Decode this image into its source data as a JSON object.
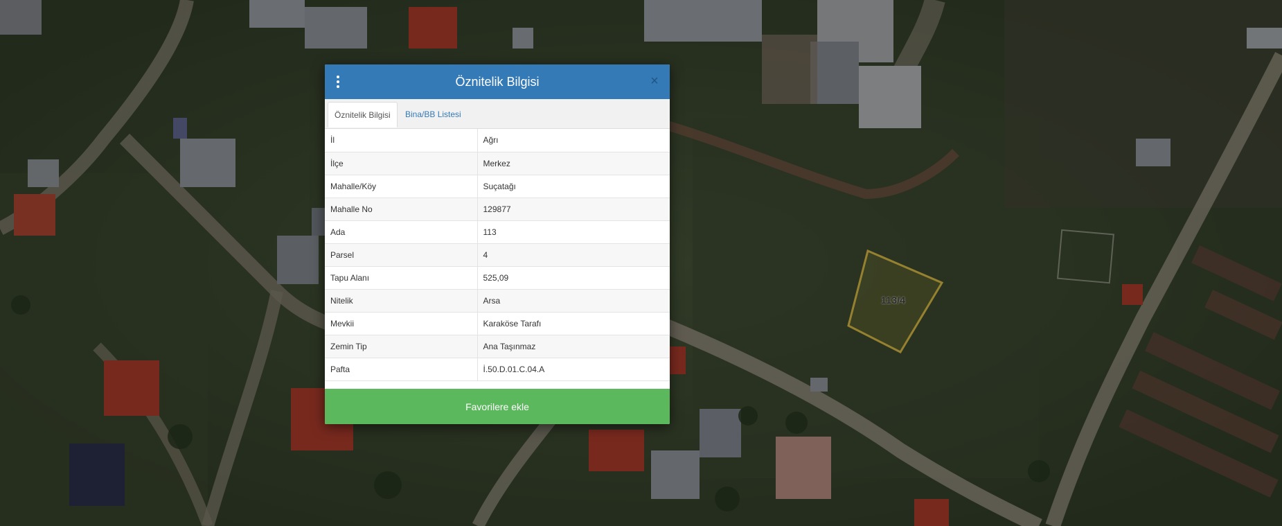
{
  "dialog": {
    "title": "Öznitelik Bilgisi",
    "menu_icon": "vertical-ellipsis-icon",
    "close_icon": "close-icon",
    "close_glyph": "×",
    "tabs": [
      {
        "label": "Öznitelik Bilgisi",
        "active": true
      },
      {
        "label": "Bina/BB Listesi",
        "active": false
      }
    ],
    "attributes": [
      {
        "key": "İl",
        "value": "Ağrı"
      },
      {
        "key": "İlçe",
        "value": "Merkez"
      },
      {
        "key": "Mahalle/Köy",
        "value": "Suçatağı"
      },
      {
        "key": "Mahalle No",
        "value": "129877"
      },
      {
        "key": "Ada",
        "value": "113"
      },
      {
        "key": "Parsel",
        "value": "4"
      },
      {
        "key": "Tapu Alanı",
        "value": "525,09"
      },
      {
        "key": "Nitelik",
        "value": "Arsa"
      },
      {
        "key": "Mevkii",
        "value": "Karaköse Tarafı"
      },
      {
        "key": "Zemin Tip",
        "value": "Ana Taşınmaz"
      },
      {
        "key": "Pafta",
        "value": "İ.50.D.01.C.04.A"
      }
    ],
    "favorite_button": "Favorilere ekle"
  },
  "map": {
    "parcel_label": "113/4",
    "parcel_outline_color": "#e6c64a"
  },
  "colors": {
    "header": "#337ab7",
    "favorite_button": "#5cb85c",
    "tab_link": "#337ab7"
  }
}
